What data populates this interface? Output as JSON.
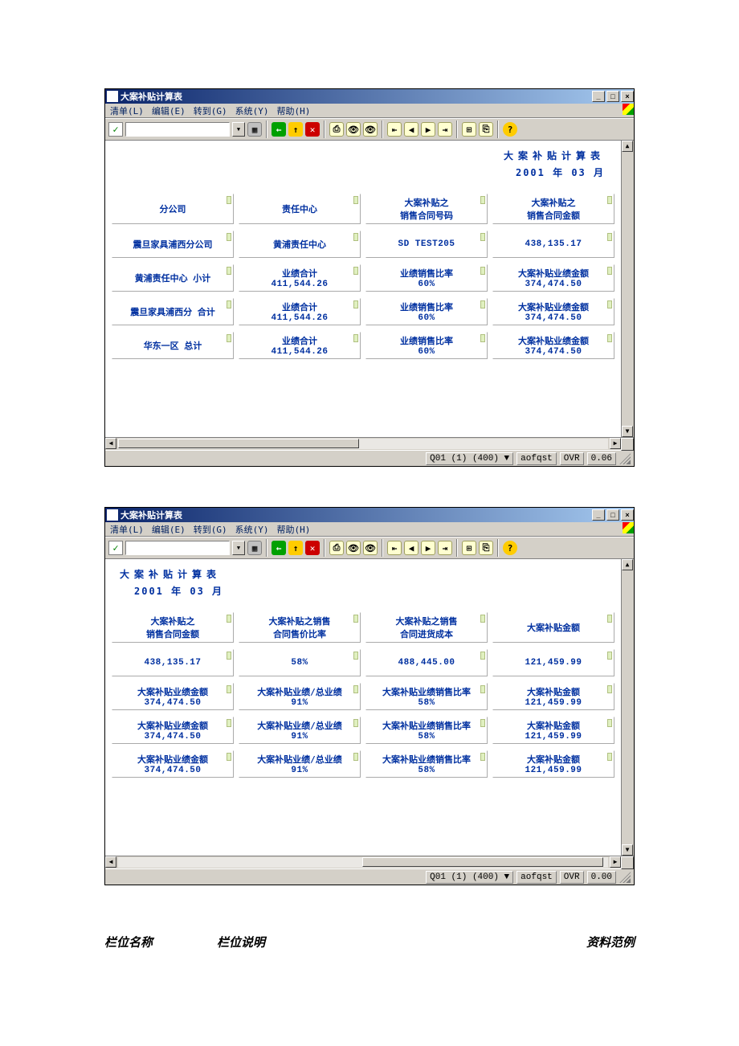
{
  "window1": {
    "title": "大案补贴计算表",
    "menu": [
      "清单(L)",
      "编辑(E)",
      "转到(G)",
      "系统(Y)",
      "帮助(H)"
    ],
    "report_title": "大案补贴计算表",
    "report_date": "2001 年 03 月",
    "rows": [
      [
        {
          "l1": "分公司",
          "l2": ""
        },
        {
          "l1": "责任中心",
          "l2": ""
        },
        {
          "l1": "大案补贴之",
          "l2": "销售合同号码"
        },
        {
          "l1": "大案补贴之",
          "l2": "销售合同金额"
        }
      ],
      [
        {
          "l1": "震旦家具浦西分公司",
          "l2": ""
        },
        {
          "l1": "黄浦责任中心",
          "l2": ""
        },
        {
          "l1": "SD TEST205",
          "l2": "",
          "num": true
        },
        {
          "l1": "438,135.17",
          "l2": "",
          "num": true
        }
      ],
      [
        {
          "l1": "黄浦责任中心   小计",
          "l2": ""
        },
        {
          "l1": "业绩合计",
          "l2": "411,544.26",
          "num2": true
        },
        {
          "l1": "业绩销售比率",
          "l2": "60%",
          "num2": true
        },
        {
          "l1": "大案补贴业绩金额",
          "l2": "374,474.50",
          "num2": true
        }
      ],
      [
        {
          "l1": "震旦家具浦西分   合计",
          "l2": ""
        },
        {
          "l1": "业绩合计",
          "l2": "411,544.26",
          "num2": true
        },
        {
          "l1": "业绩销售比率",
          "l2": "60%",
          "num2": true
        },
        {
          "l1": "大案补贴业绩金额",
          "l2": "374,474.50",
          "num2": true
        }
      ],
      [
        {
          "l1": "华东一区     总计",
          "l2": ""
        },
        {
          "l1": "业绩合计",
          "l2": "411,544.26",
          "num2": true
        },
        {
          "l1": "业绩销售比率",
          "l2": "60%",
          "num2": true
        },
        {
          "l1": "大案补贴业绩金额",
          "l2": "374,474.50",
          "num2": true
        }
      ]
    ],
    "status": {
      "a": "Q01 (1) (400) ▼",
      "b": "aofqst",
      "c": "OVR",
      "d": "0.06"
    }
  },
  "window2": {
    "title": "大案补贴计算表",
    "menu": [
      "清单(L)",
      "编辑(E)",
      "转到(G)",
      "系统(Y)",
      "帮助(H)"
    ],
    "report_title": "大案补贴计算表",
    "report_date": "2001 年 03 月",
    "rows": [
      [
        {
          "l1": "大案补贴之",
          "l2": "销售合同金额"
        },
        {
          "l1": "大案补贴之销售",
          "l2": "合同售价比率"
        },
        {
          "l1": "大案补贴之销售",
          "l2": "合同进货成本"
        },
        {
          "l1": "大案补贴金额",
          "l2": ""
        }
      ],
      [
        {
          "l1": "438,135.17",
          "l2": "",
          "num": true
        },
        {
          "l1": "58%",
          "l2": "",
          "num": true
        },
        {
          "l1": "488,445.00",
          "l2": "",
          "num": true
        },
        {
          "l1": "121,459.99",
          "l2": "",
          "num": true
        }
      ],
      [
        {
          "l1": "大案补贴业绩金额",
          "l2": "374,474.50",
          "num2": true
        },
        {
          "l1": "大案补贴业绩/总业绩",
          "l2": "91%",
          "num2": true
        },
        {
          "l1": "大案补贴业绩销售比率",
          "l2": "58%",
          "num2": true
        },
        {
          "l1": "大案补贴金额",
          "l2": "121,459.99",
          "num2": true
        }
      ],
      [
        {
          "l1": "大案补贴业绩金额",
          "l2": "374,474.50",
          "num2": true
        },
        {
          "l1": "大案补贴业绩/总业绩",
          "l2": "91%",
          "num2": true
        },
        {
          "l1": "大案补贴业绩销售比率",
          "l2": "58%",
          "num2": true
        },
        {
          "l1": "大案补贴金额",
          "l2": "121,459.99",
          "num2": true
        }
      ],
      [
        {
          "l1": "大案补贴业绩金额",
          "l2": "374,474.50",
          "num2": true
        },
        {
          "l1": "大案补贴业绩/总业绩",
          "l2": "91%",
          "num2": true
        },
        {
          "l1": "大案补贴业绩销售比率",
          "l2": "58%",
          "num2": true
        },
        {
          "l1": "大案补贴金额",
          "l2": "121,459.99",
          "num2": true
        }
      ]
    ],
    "status": {
      "a": "Q01 (1) (400) ▼",
      "b": "aofqst",
      "c": "OVR",
      "d": "0.00"
    }
  },
  "footer": {
    "col1": "栏位名称",
    "col2": "栏位说明",
    "col3": "资料范例"
  }
}
